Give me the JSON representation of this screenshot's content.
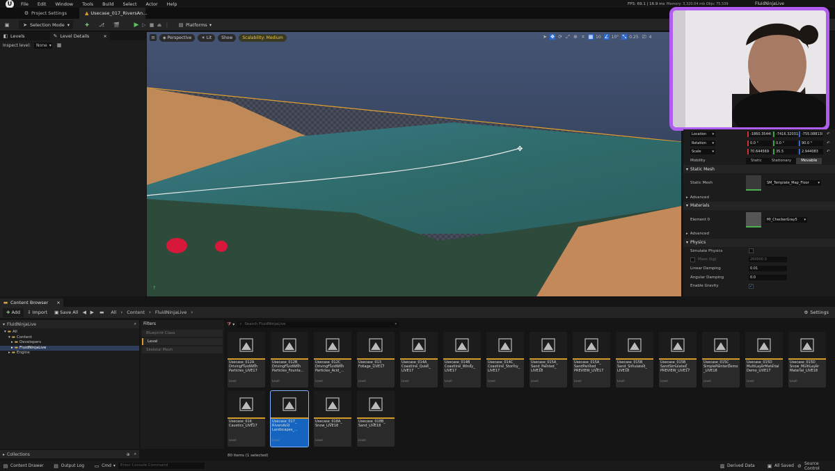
{
  "menu": {
    "items": [
      "File",
      "Edit",
      "Window",
      "Tools",
      "Build",
      "Select",
      "Actor",
      "Help"
    ]
  },
  "stats": {
    "fps": "FPS: 69.1 | 16.9 ms",
    "memory": "Memory: 3,320.04 mb  Objs: 75,539",
    "project": "FluidNinjaLive"
  },
  "tabs": {
    "project_settings": "Project Settings",
    "level": "Usecase_017_RiversAn..."
  },
  "toolbar": {
    "selection_mode": "Selection Mode",
    "platforms": "Platforms"
  },
  "left_panel": {
    "levels_tab": "Levels",
    "details_tab": "Level Details",
    "inspect_label": "Inspect level:",
    "inspect_value": "None"
  },
  "viewport": {
    "perspective": "Perspective",
    "lit": "Lit",
    "show": "Show",
    "scalability": "Scalability: Medium",
    "grid_snap": "10",
    "angle_snap": "10°",
    "scale_snap": "0.25",
    "cam_speed": "4"
  },
  "details": {
    "transform": [
      {
        "label": "Location",
        "x": "-1860.3544l",
        "y": "-7416.32031",
        "z": "-755.08813l"
      },
      {
        "label": "Rotation",
        "x": "0.0 °",
        "y": "0.0 °",
        "z": "90.0 °"
      },
      {
        "label": "Scale",
        "x": "70.644569",
        "y": "35.5",
        "z": "2.944083"
      }
    ],
    "mobility": {
      "label": "Mobility",
      "options": [
        "Static",
        "Stationary",
        "Movable"
      ],
      "active": "Movable"
    },
    "static_mesh_section": "Static Mesh",
    "static_mesh_label": "Static Mesh",
    "static_mesh_value": "SM_Template_Map_Floor",
    "advanced": "Advanced",
    "materials_section": "Materials",
    "element_label": "Element 0",
    "element_value": "MI_CheckerGray5",
    "advanced2": "Advanced",
    "physics_section": "Physics",
    "simulate_physics": "Simulate Physics",
    "mass": "Mass (kg)",
    "mass_value": "260000.0",
    "linear_damping": "Linear Damping",
    "linear_damping_value": "0.01",
    "angular_damping": "Angular Damping",
    "angular_damping_value": "0.0",
    "enable_gravity": "Enable Gravity"
  },
  "content_browser": {
    "tab": "Content Browser",
    "add": "Add",
    "import": "Import",
    "save_all": "Save All",
    "breadcrumb": [
      "All",
      "Content",
      "FluidNinjaLive"
    ],
    "settings": "Settings",
    "tree_header": "FluidNinjaLive",
    "tree": [
      "All",
      "Content",
      "Developers",
      "FluidNinjaLive",
      "Engine"
    ],
    "filters_label": "Filters",
    "filters": [
      "Blueprint Class",
      "Level",
      "Skeletal Mesh"
    ],
    "search_placeholder": "Search FluidNinjaLive",
    "collections": "Collections",
    "count": "80 items (1 selected)",
    "assets": [
      {
        "name": "Usecase_012A_\nDrivingFluidWith\nParticles_LIVE17",
        "type": "Level"
      },
      {
        "name": "Usecase_012B_\nDrivingFluidWith\nParticles_Founta...",
        "type": "Level"
      },
      {
        "name": "Usecase_012C_\nDrivingFluidWith\nParticles_Acid_...",
        "type": "Level"
      },
      {
        "name": "Usecase_013_\nFoliage_LIVE17",
        "type": "Level"
      },
      {
        "name": "Usecase_014A_\nCoastline_Quiet_\nLIVE17",
        "type": "Level"
      },
      {
        "name": "Usecase_014B_\nCoastline_Windy_\nLIVE17",
        "type": "Level"
      },
      {
        "name": "Usecase_014C_\nCoastline_Stormy_\nLIVE17",
        "type": "Level"
      },
      {
        "name": "Usecase_015A_\nSand_Painted_\nLIVE18",
        "type": "Level"
      },
      {
        "name": "Usecase_015A_\nSandPainted_\nPREVIEW_LIVE17",
        "type": "Level"
      },
      {
        "name": "Usecase_015B_\nSand_Simulated_\nLIVE18",
        "type": "Level"
      },
      {
        "name": "Usecase_015B_\nSandSimulated_\nPREVIEW_LIVE17",
        "type": "Level"
      },
      {
        "name": "Usecase_015C_\nSimplePainterDemo\n_LIVE18",
        "type": "Level"
      },
      {
        "name": "Usecase_015D_\nMultiLayerMaterial\nDemo_LIVE17",
        "type": "Level"
      },
      {
        "name": "Usecase_015D_\nSnow_MultiLayer\nMaterial_LIVE18",
        "type": "Level"
      },
      {
        "name": "Usecase_016_\nCaustics_LIVE17",
        "type": "Level"
      },
      {
        "name": "Usecase_017_\nRiversAnd\nLandscapes_...",
        "type": "Level"
      },
      {
        "name": "Usecase_018A_\nSnow_LIVE18",
        "type": "Level"
      },
      {
        "name": "Usecase_018B_\nSand_LIVE18",
        "type": "Level"
      }
    ]
  },
  "status": {
    "content_drawer": "Content Drawer",
    "output_log": "Output Log",
    "cmd": "Cmd",
    "console_placeholder": "Enter Console Command",
    "derived": "Derived Data",
    "saved": "All Saved",
    "source": "Source Control"
  }
}
